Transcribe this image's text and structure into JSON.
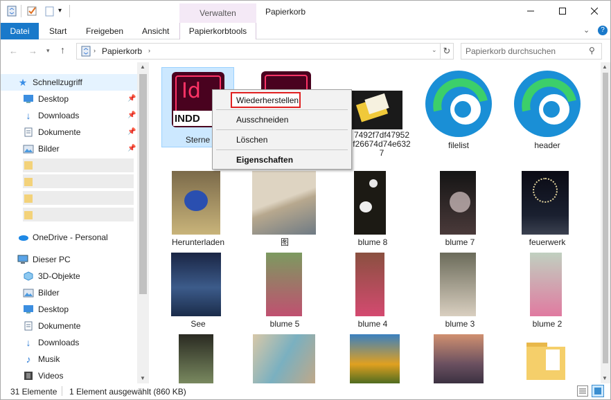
{
  "window": {
    "title": "Papierkorb",
    "context_tab": "Verwalten",
    "minimize": "─",
    "maximize": "☐",
    "close": "✕"
  },
  "ribbon": {
    "tabs": [
      "Datei",
      "Start",
      "Freigeben",
      "Ansicht"
    ],
    "tools_tab": "Papierkorbtools",
    "expand_icon": "chevron-down-icon",
    "help_icon": "help-icon"
  },
  "address": {
    "path": "Papierkorb",
    "search_placeholder": "Papierkorb durchsuchen"
  },
  "nav": {
    "quick_access": "Schnellzugriff",
    "quick_items": [
      "Desktop",
      "Downloads",
      "Dokumente",
      "Bilder"
    ],
    "onedrive": "OneDrive - Personal",
    "this_pc": "Dieser PC",
    "pc_items": [
      "3D-Objekte",
      "Bilder",
      "Desktop",
      "Dokumente",
      "Downloads",
      "Musik",
      "Videos"
    ]
  },
  "files": {
    "row1": [
      "Sterne",
      "",
      "7492f7df47952\nf26674d74e632\n7",
      "filelist",
      "header"
    ],
    "row2": [
      "Herunterladen",
      "图",
      "blume 8",
      "blume 7",
      "feuerwerk"
    ],
    "row3": [
      "See",
      "blume 5",
      "blume 4",
      "blume 3",
      "blume 2"
    ],
    "indd_label": "INDD",
    "id_label": "Id"
  },
  "context_menu": {
    "items": [
      "Wiederherstellen",
      "Ausschneiden",
      "Löschen",
      "Eigenschaften"
    ]
  },
  "status": {
    "count": "31 Elemente",
    "selection": "1 Element ausgewählt (860 KB)"
  },
  "colors": {
    "accent": "#1979ca",
    "manage_tab": "#f4e9f6",
    "highlight_border": "#e02020",
    "selection": "#cce8ff"
  }
}
